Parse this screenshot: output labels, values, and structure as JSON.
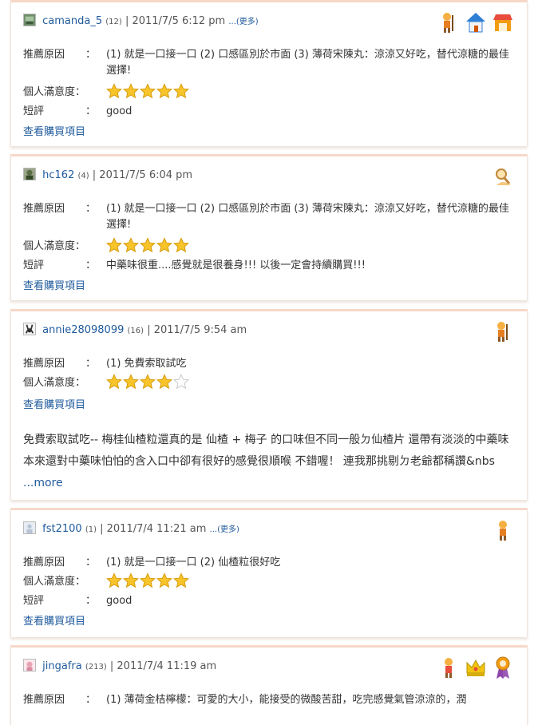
{
  "labels": {
    "reason": "推薦原因",
    "satisfaction": "個人滿意度：",
    "short_comment": "短評",
    "colon": "：",
    "view_purchase": "查看購買項目"
  },
  "reviews": [
    {
      "user": "camanda_5",
      "level": "(12)",
      "datetime": "| 2011/7/5  6:12 pm",
      "more": "...(更多)",
      "reason": "(1) 就是一口接一口  (2) 口感區別於市面  (3) 薄荷宋陳丸：涼涼又好吃，替代涼糖的最佳選擇!",
      "rating": 5,
      "comment": "good",
      "badges": [
        "cartoon-character-icon",
        "house-icon",
        "shop-icon"
      ]
    },
    {
      "user": "hc162",
      "level": "(4)",
      "datetime": "| 2011/7/5  6:04 pm",
      "more": "",
      "reason": "(1) 就是一口接一口  (2) 口感區別於市面  (3) 薄荷宋陳丸：涼涼又好吃，替代涼糖的最佳選擇!",
      "rating": 5,
      "comment": "中藥味很重....感覺就是很養身!!! 以後一定會持續購買!!!",
      "badges": [
        "magnifier-person-icon"
      ]
    },
    {
      "user": "annie28098099",
      "level": "(16)",
      "datetime": "| 2011/7/5  9:54 am",
      "more": "",
      "reason": "(1) 免費索取試吃",
      "rating": 4,
      "comment": "",
      "long_text": "免費索取試吃-- 梅桂仙楂粒還真的是 仙楂 + 梅子 的口味但不同一般ㄉ仙楂片 還帶有淡淡的中藥味本來還對中藥味怕怕的含入口中卻有很好的感覺很順喉  不錯喔！ 連我那挑剔ㄉ老爺都稱讚&nbs",
      "long_more": " ...more",
      "badges": [
        "cartoon-character-icon"
      ]
    },
    {
      "user": "fst2100",
      "level": "(1)",
      "datetime": "| 2011/7/4  11:21 am",
      "more": "...(更多)",
      "reason": "(1) 就是一口接一口  (2) 仙楂粒很好吃",
      "rating": 5,
      "comment": "good",
      "badges": [
        "cartoon-character-icon"
      ]
    },
    {
      "user": "jingafra",
      "level": "(213)",
      "datetime": "| 2011/7/4  11:19 am",
      "more": "",
      "reason": "(1) 薄荷金桔檸檬：可愛的大小，能接受的微酸苦甜，吃完感覺氣管涼涼的，潤",
      "badges": [
        "cartoon-character-icon",
        "crown-icon",
        "medal-icon"
      ]
    }
  ]
}
